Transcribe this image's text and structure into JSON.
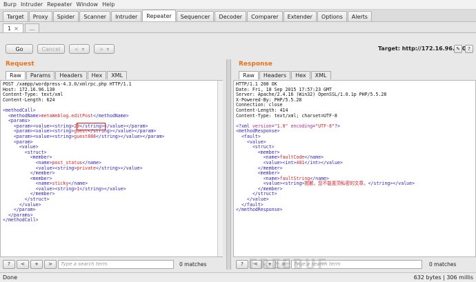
{
  "menu": [
    "Burp",
    "Intruder",
    "Repeater",
    "Window",
    "Help"
  ],
  "tabs": [
    {
      "label": "Target",
      "active": false
    },
    {
      "label": "Proxy",
      "active": false
    },
    {
      "label": "Spider",
      "active": false
    },
    {
      "label": "Scanner",
      "active": false
    },
    {
      "label": "Intruder",
      "active": false
    },
    {
      "label": "Repeater",
      "active": true
    },
    {
      "label": "Sequencer",
      "active": false
    },
    {
      "label": "Decoder",
      "active": false
    },
    {
      "label": "Comparer",
      "active": false
    },
    {
      "label": "Extender",
      "active": false
    },
    {
      "label": "Options",
      "active": false
    },
    {
      "label": "Alerts",
      "active": false
    }
  ],
  "subtabs": {
    "first": "1",
    "first_close": "×",
    "more": "..."
  },
  "toolbar": {
    "go": "Go",
    "cancel": "Cancel",
    "back": "<",
    "back_menu": "▾",
    "forward": ">",
    "forward_menu": "▾",
    "target_label": "Target: http://172.16.96.130",
    "edit_icon": "✎",
    "help_icon": "?"
  },
  "request": {
    "title": "Request",
    "tabs": [
      "Raw",
      "Params",
      "Headers",
      "Hex",
      "XML"
    ],
    "active_tab": "Raw",
    "lines": [
      "POST /xampp/wordpress-4.3.0/xmlrpc.php HTTP/1.1",
      "Host: 172.16.96.130",
      "Content-Type: text/xml",
      "Content-Length: 624",
      "",
      "<methodCall>",
      "  <methodName>metaWeblog.editPost</methodName>",
      "  <params>",
      "    <param><value><string>20</string></value></param>",
      "    <param><value><string>guest</string></value></param>",
      "    <param><value><string>guest888</string></value></param>",
      "    <param>",
      "      <value>",
      "        <struct>",
      "          <member>",
      "            <name>post_status</name>",
      "            <value><string>private</string></value>",
      "          </member>",
      "          <member>",
      "            <name>sticky</name>",
      "            <value><string>1</string></value>",
      "          </member>",
      "        </struct>",
      "      </value>",
      "    </param>",
      "  </params>",
      "</methodCall>"
    ],
    "search_placeholder": "Type a search term",
    "matches": "0 matches",
    "nav": [
      "?",
      "<",
      "+",
      ">"
    ]
  },
  "response": {
    "title": "Response",
    "tabs": [
      "Raw",
      "Headers",
      "Hex",
      "XML"
    ],
    "active_tab": "Raw",
    "lines": [
      "HTTP/1.1 200 OK",
      "Date: Fri, 18 Sep 2015 17:57:23 GMT",
      "Server: Apache/2.4.16 (Win32) OpenSSL/1.0.1p PHP/5.5.28",
      "X-Powered-By: PHP/5.5.28",
      "Connection: close",
      "Content-Length: 414",
      "Content-Type: text/xml; charset=UTF-8",
      "",
      "<?xml version=\"1.0\" encoding=\"UTF-8\"?>",
      "<methodResponse>",
      "  <fault>",
      "    <value>",
      "      <struct>",
      "        <member>",
      "          <name>faultCode</name>",
      "          <value><int>401</int></value>",
      "        </member>",
      "        <member>",
      "          <name>faultString</name>",
      "          <value><string>抱歉，您不能置顶私密的文章。</string></value>",
      "        </member>",
      "      </struct>",
      "    </value>",
      "  </fault>",
      "</methodResponse>"
    ],
    "search_placeholder": "Type a search term",
    "matches": "0 matches",
    "nav": [
      "?",
      "<",
      "+",
      ">"
    ]
  },
  "status": {
    "left": "Done",
    "right": "632 bytes | 306 millis"
  },
  "watermark": "FREEBUF",
  "colors": {
    "accent": "#e8731a",
    "tag": "#2f1fb4",
    "string": "#d2202a",
    "highlight": "#e11111"
  }
}
